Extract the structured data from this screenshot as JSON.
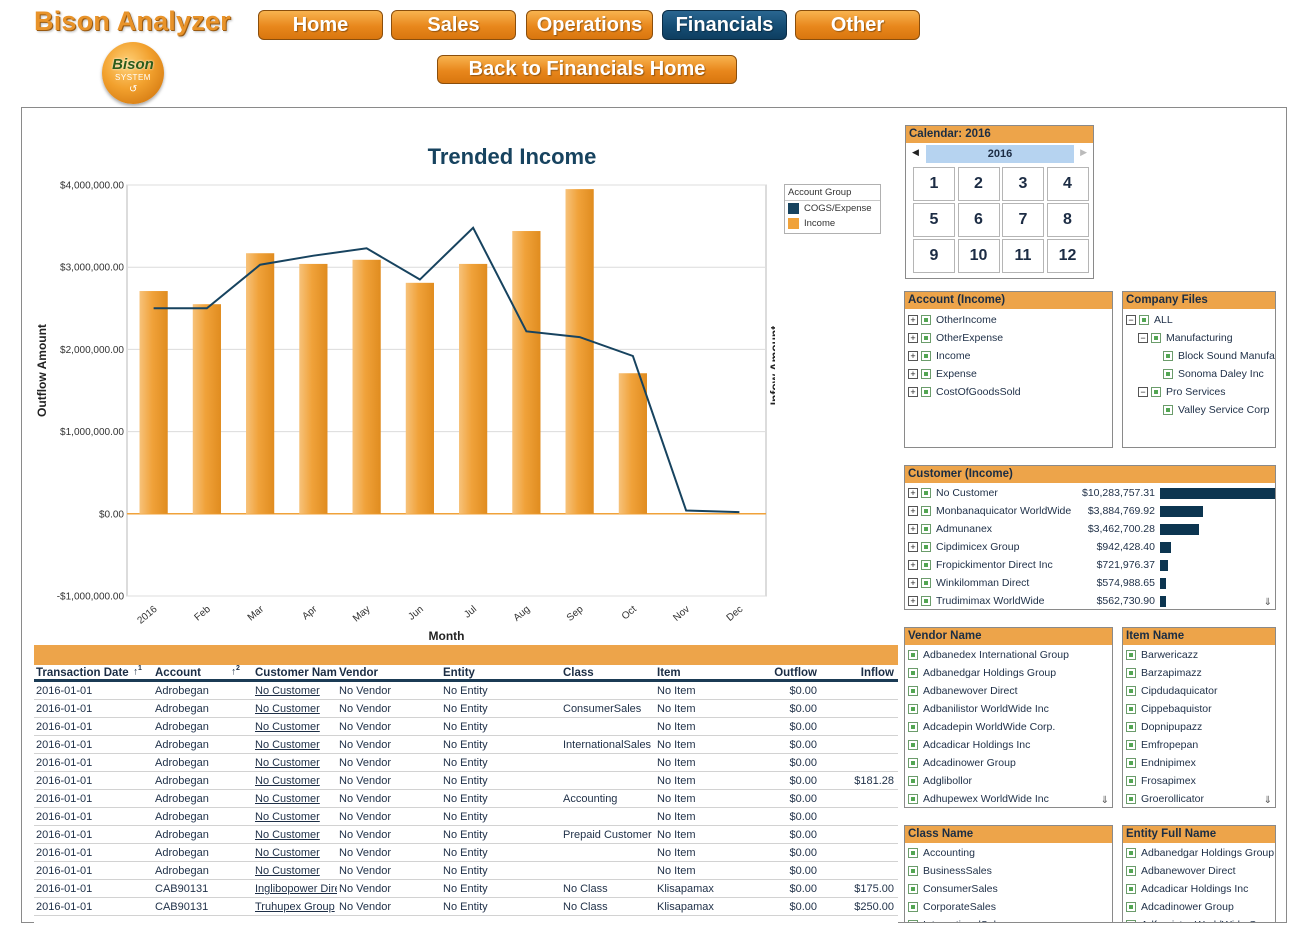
{
  "app": {
    "title": "Bison Analyzer",
    "logo_text": "Bison",
    "logo_sub": "SYSTEM"
  },
  "nav": {
    "items": [
      {
        "label": "Home",
        "active": false
      },
      {
        "label": "Sales",
        "active": false
      },
      {
        "label": "Operations",
        "active": false
      },
      {
        "label": "Financials",
        "active": true
      },
      {
        "label": "Other",
        "active": false
      }
    ],
    "back_label": "Back to Financials Home"
  },
  "chart_data": {
    "type": "bar",
    "title": "Trended Income",
    "xlabel": "Month",
    "ylabel": "Outflow Amount",
    "y2label": "Infow Amount",
    "categories": [
      "2016",
      "Feb",
      "Mar",
      "Apr",
      "May",
      "Jun",
      "Jul",
      "Aug",
      "Sep",
      "Oct",
      "Nov",
      "Dec"
    ],
    "yticks": [
      "$4,000,000.00",
      "$3,000,000.00",
      "$2,000,000.00",
      "$1,000,000.00",
      "$0.00",
      "-$1,000,000.00"
    ],
    "ylim": [
      -1000000,
      4000000
    ],
    "grid": true,
    "legend": {
      "title": "Account Group",
      "position": "right"
    },
    "series": [
      {
        "name": "Income",
        "kind": "bar",
        "color": "#f0a23a",
        "values": [
          2710000,
          2550000,
          3170000,
          3040000,
          3090000,
          2810000,
          3040000,
          3440000,
          3950000,
          1710000,
          0,
          0
        ]
      },
      {
        "name": "COGS/Expense",
        "kind": "line",
        "color": "#17435f",
        "values": [
          2500000,
          2500000,
          3030000,
          3140000,
          3230000,
          2850000,
          3480000,
          2220000,
          2150000,
          1920000,
          40000,
          20000
        ]
      }
    ]
  },
  "calendar": {
    "title": "Calendar: 2016",
    "year": "2016",
    "months": [
      "1",
      "2",
      "3",
      "4",
      "5",
      "6",
      "7",
      "8",
      "9",
      "10",
      "11",
      "12"
    ]
  },
  "account_income": {
    "title": "Account (Income)",
    "items": [
      "OtherIncome",
      "OtherExpense",
      "Income",
      "Expense",
      "CostOfGoodsSold"
    ]
  },
  "company_files": {
    "title": "Company Files",
    "items": [
      {
        "label": "ALL",
        "level": 0,
        "expander": "−"
      },
      {
        "label": "Manufacturing",
        "level": 1,
        "expander": "−"
      },
      {
        "label": "Block Sound Manufac",
        "level": 2,
        "expander": ""
      },
      {
        "label": "Sonoma Daley Inc",
        "level": 2,
        "expander": ""
      },
      {
        "label": "Pro Services",
        "level": 1,
        "expander": "−"
      },
      {
        "label": "Valley Service Corp",
        "level": 2,
        "expander": ""
      }
    ]
  },
  "customer_income": {
    "title": "Customer (Income)",
    "items": [
      {
        "name": "No Customer",
        "amount": "$10,283,757.31",
        "value": 10283757.31
      },
      {
        "name": "Monbanaquicator WorldWide",
        "amount": "$3,884,769.92",
        "value": 3884769.92
      },
      {
        "name": "Admunanex",
        "amount": "$3,462,700.28",
        "value": 3462700.28
      },
      {
        "name": "Cipdimicex  Group",
        "amount": "$942,428.40",
        "value": 942428.4
      },
      {
        "name": "Fropickimentor Direct Inc",
        "amount": "$721,976.37",
        "value": 721976.37
      },
      {
        "name": "Winkilomman Direct",
        "amount": "$574,988.65",
        "value": 574988.65
      },
      {
        "name": "Trudimimax WorldWide",
        "amount": "$562,730.90",
        "value": 562730.9
      }
    ]
  },
  "vendor_name": {
    "title": "Vendor Name",
    "items": [
      "Adbanedex International Group",
      "Adbanedgar Holdings Group",
      "Adbanewover Direct",
      "Adbanilistor WorldWide Inc",
      "Adcadepin WorldWide Corp.",
      "Adcadicar Holdings Inc",
      "Adcadinower  Group",
      "Adglibollor",
      "Adhupewex WorldWide Inc"
    ]
  },
  "item_name": {
    "title": "Item Name",
    "items": [
      "Barwericazz",
      "Barzapimazz",
      "Cipdudaquicator",
      "Cippebaquistor",
      "Dopnipupazz",
      "Emfropepan",
      "Endnipimex",
      "Frosapimex",
      "Groerollicator"
    ]
  },
  "class_name": {
    "title": "Class Name",
    "items": [
      "Accounting",
      "BusinessSales",
      "ConsumerSales",
      "CorporateSales",
      "InternationalSales"
    ]
  },
  "entity_full_name": {
    "title": "Entity Full Name",
    "items": [
      "Adbanedgar Holdings Group",
      "Adbanewover Direct",
      "Adcadicar Holdings Inc",
      "Adcadinower  Group",
      "Adfropistor WorldWide Corp."
    ]
  },
  "grid": {
    "columns": [
      {
        "label": "Transaction Date",
        "sort": "1"
      },
      {
        "label": "Account",
        "sort": "2"
      },
      {
        "label": "Customer Name",
        "sort": ""
      },
      {
        "label": "Vendor",
        "sort": ""
      },
      {
        "label": "Entity",
        "sort": ""
      },
      {
        "label": "Class",
        "sort": ""
      },
      {
        "label": "Item",
        "sort": ""
      },
      {
        "label": "Outflow",
        "sort": ""
      },
      {
        "label": "Inflow",
        "sort": ""
      }
    ],
    "rows": [
      [
        "2016-01-01",
        "Adrobegan",
        "No Customer",
        "No Vendor",
        "No Entity",
        "",
        "No Item",
        "$0.00",
        ""
      ],
      [
        "2016-01-01",
        "Adrobegan",
        "No Customer",
        "No Vendor",
        "No Entity",
        "ConsumerSales",
        "No Item",
        "$0.00",
        ""
      ],
      [
        "2016-01-01",
        "Adrobegan",
        "No Customer",
        "No Vendor",
        "No Entity",
        "",
        "No Item",
        "$0.00",
        ""
      ],
      [
        "2016-01-01",
        "Adrobegan",
        "No Customer",
        "No Vendor",
        "No Entity",
        "InternationalSales",
        "No Item",
        "$0.00",
        ""
      ],
      [
        "2016-01-01",
        "Adrobegan",
        "No Customer",
        "No Vendor",
        "No Entity",
        "",
        "No Item",
        "$0.00",
        ""
      ],
      [
        "2016-01-01",
        "Adrobegan",
        "No Customer",
        "No Vendor",
        "No Entity",
        "",
        "No Item",
        "$0.00",
        "$181.28"
      ],
      [
        "2016-01-01",
        "Adrobegan",
        "No Customer",
        "No Vendor",
        "No Entity",
        "Accounting",
        "No Item",
        "$0.00",
        ""
      ],
      [
        "2016-01-01",
        "Adrobegan",
        "No Customer",
        "No Vendor",
        "No Entity",
        "",
        "No Item",
        "$0.00",
        ""
      ],
      [
        "2016-01-01",
        "Adrobegan",
        "No Customer",
        "No Vendor",
        "No Entity",
        "Prepaid Customer",
        "No Item",
        "$0.00",
        ""
      ],
      [
        "2016-01-01",
        "Adrobegan",
        "No Customer",
        "No Vendor",
        "No Entity",
        "",
        "No Item",
        "$0.00",
        ""
      ],
      [
        "2016-01-01",
        "Adrobegan",
        "No Customer",
        "No Vendor",
        "No Entity",
        "",
        "No Item",
        "$0.00",
        ""
      ],
      [
        "2016-01-01",
        "CAB90131",
        "Inglibopower Direct",
        "No Vendor",
        "No Entity",
        "No Class",
        "Klisapamax",
        "$0.00",
        "$175.00"
      ],
      [
        "2016-01-01",
        "CAB90131",
        "Truhupex  Group",
        "No Vendor",
        "No Entity",
        "No Class",
        "Klisapamax",
        "$0.00",
        "$250.00"
      ]
    ]
  }
}
